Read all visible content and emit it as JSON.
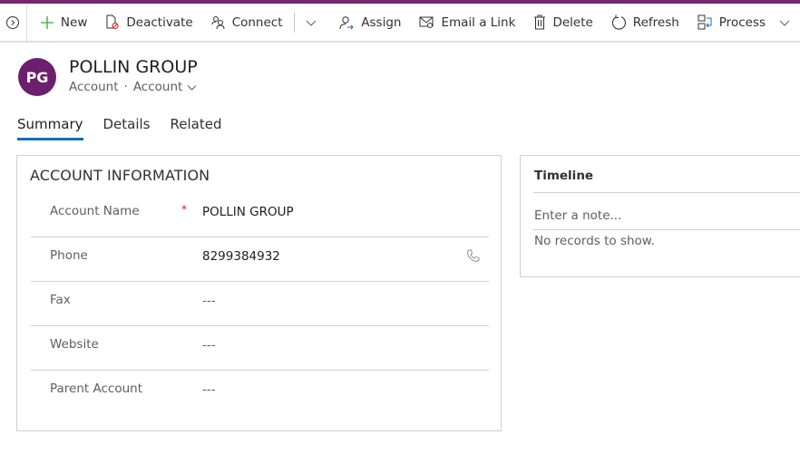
{
  "commandbar": {
    "items": [
      {
        "label": "New",
        "icon": "plus-icon"
      },
      {
        "label": "Deactivate",
        "icon": "deactivate-icon"
      },
      {
        "label": "Connect",
        "icon": "connect-icon"
      },
      {
        "label": "Assign",
        "icon": "assign-icon"
      },
      {
        "label": "Email a Link",
        "icon": "email-link-icon"
      },
      {
        "label": "Delete",
        "icon": "delete-icon"
      },
      {
        "label": "Refresh",
        "icon": "refresh-icon"
      },
      {
        "label": "Process",
        "icon": "process-icon"
      }
    ],
    "accent": "#742774"
  },
  "header": {
    "initials": "PG",
    "avatar_color": "#6b1f6e",
    "title": "POLLIN GROUP",
    "entity": "Account",
    "separator": "·",
    "form": "Account"
  },
  "tabs": [
    {
      "label": "Summary",
      "active": true
    },
    {
      "label": "Details",
      "active": false
    },
    {
      "label": "Related",
      "active": false
    }
  ],
  "account_info": {
    "title": "ACCOUNT INFORMATION",
    "fields": [
      {
        "label": "Account Name",
        "required": "*",
        "value": "POLLIN GROUP"
      },
      {
        "label": "Phone",
        "required": "",
        "value": "8299384932"
      },
      {
        "label": "Fax",
        "required": "",
        "value": "---"
      },
      {
        "label": "Website",
        "required": "",
        "value": "---"
      },
      {
        "label": "Parent Account",
        "required": "",
        "value": "---"
      }
    ]
  },
  "timeline": {
    "title": "Timeline",
    "note_placeholder": "Enter a note...",
    "empty_text": "No records to show."
  }
}
